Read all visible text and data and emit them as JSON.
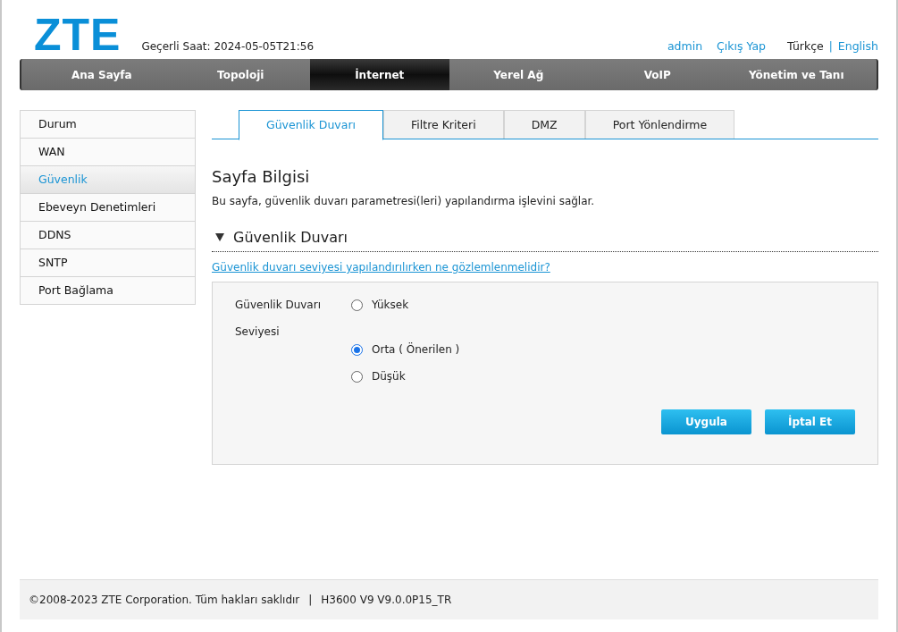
{
  "header": {
    "logo": "ZTE",
    "current_time": "Geçerli Saat: 2024-05-05T21:56",
    "user": "admin",
    "logout": "Çıkış Yap",
    "languages": [
      {
        "label": "Türkçe",
        "selected": true
      },
      {
        "label": "English",
        "selected": false
      }
    ],
    "language_separator": "|"
  },
  "nav": [
    {
      "label": "Ana Sayfa",
      "selected": false
    },
    {
      "label": "Topoloji",
      "selected": false
    },
    {
      "label": "İnternet",
      "selected": true
    },
    {
      "label": "Yerel Ağ",
      "selected": false
    },
    {
      "label": "VoIP",
      "selected": false
    },
    {
      "label": "Yönetim ve Tanı",
      "selected": false
    }
  ],
  "sidebar": {
    "items": [
      {
        "label": "Durum",
        "selected": false
      },
      {
        "label": "WAN",
        "selected": false
      },
      {
        "label": "Güvenlik",
        "selected": true
      },
      {
        "label": "Ebeveyn Denetimleri",
        "selected": false
      },
      {
        "label": "DDNS",
        "selected": false
      },
      {
        "label": "SNTP",
        "selected": false
      },
      {
        "label": "Port Bağlama",
        "selected": false
      }
    ]
  },
  "tabs": [
    {
      "label": "Güvenlik Duvarı",
      "selected": true
    },
    {
      "label": "Filtre Kriteri",
      "selected": false
    },
    {
      "label": "DMZ",
      "selected": false
    },
    {
      "label": "Port Yönlendirme",
      "selected": false
    }
  ],
  "page_info": {
    "title": "Sayfa Bilgisi",
    "description": "Bu sayfa, güvenlik duvarı parametresi(leri) yapılandırma işlevini sağlar."
  },
  "section": {
    "title": "Güvenlik Duvarı",
    "expanded": true,
    "help_link": "Güvenlik duvarı seviyesi yapılandırılırken ne gözlemlenmelidir?",
    "field_label": [
      "Güvenlik Duvarı",
      "Seviyesi"
    ],
    "options": [
      {
        "label": "Yüksek",
        "selected": false
      },
      {
        "label": "Orta ( Önerilen )",
        "selected": true
      },
      {
        "label": "Düşük",
        "selected": false
      }
    ],
    "buttons": [
      "Uygula",
      "İptal Et"
    ]
  },
  "footer": {
    "copyright": "©2008-2023 ZTE Corporation. Tüm hakları saklıdır",
    "separator": "|",
    "version": "H3600 V9 V9.0.0P15_TR"
  }
}
